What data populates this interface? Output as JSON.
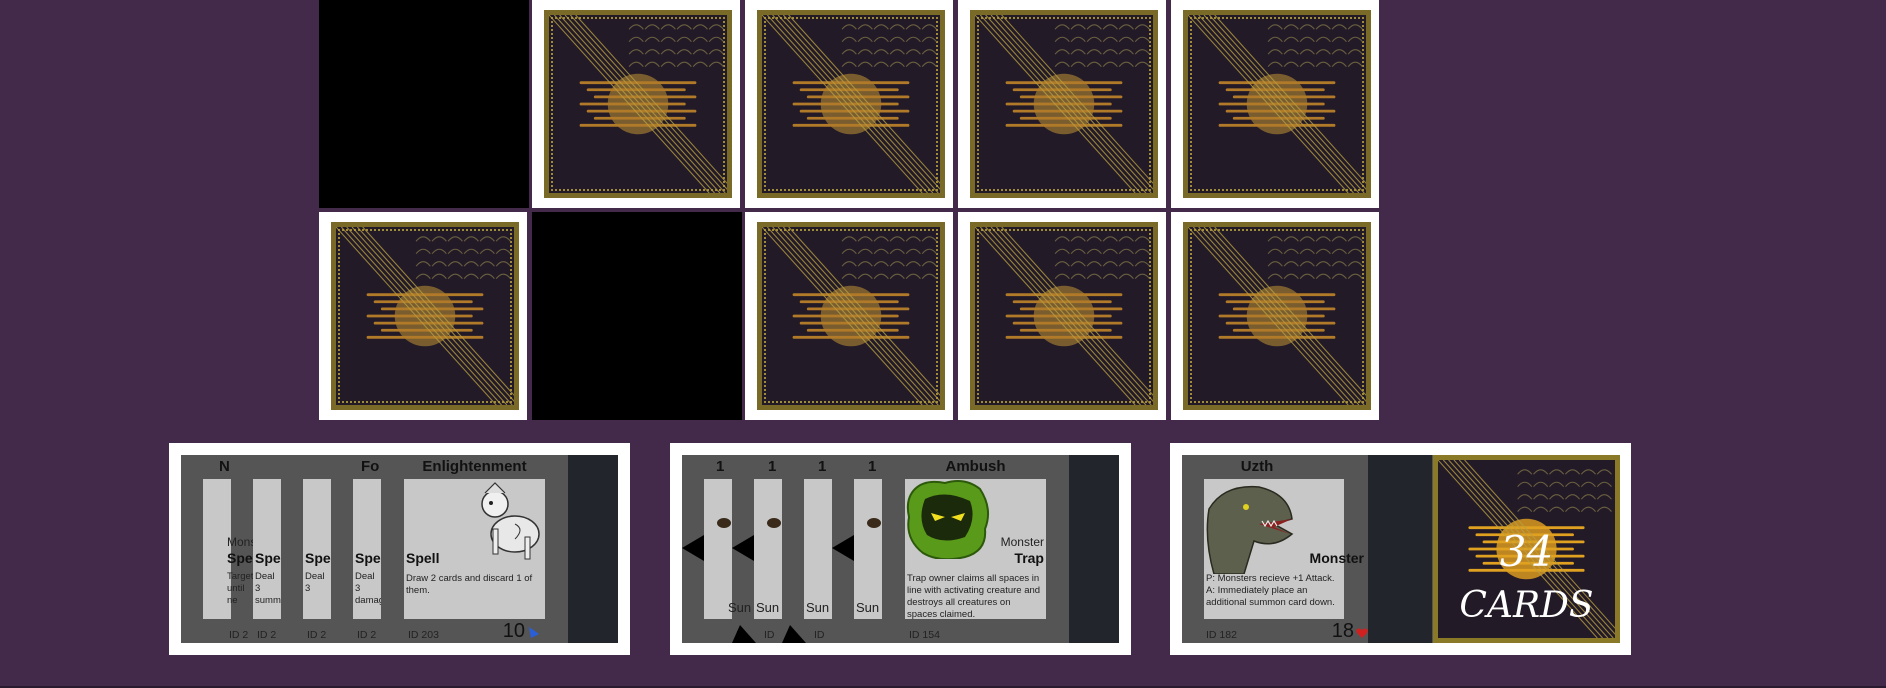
{
  "board": {
    "rows": [
      [
        "empty",
        "back",
        "back",
        "back",
        "back"
      ],
      [
        "back",
        "empty",
        "back",
        "back",
        "back"
      ]
    ]
  },
  "hand1": {
    "slim_cards": [
      {
        "title": "N",
        "type": "Spe",
        "sub": "Mons",
        "desc": "Target until ne",
        "id": "ID  2"
      },
      {
        "title": "",
        "type": "Spe",
        "sub": "",
        "desc": "Deal 3 summ",
        "id": "ID  2"
      },
      {
        "title": "",
        "type": "Spe",
        "sub": "",
        "desc": "Deal 3",
        "id": "ID  2"
      },
      {
        "title": "Fo",
        "type": "Spe",
        "sub": "",
        "desc": "Deal 3 damag",
        "id": "ID  2"
      }
    ],
    "main": {
      "title": "Enlightenment",
      "type": "Spell",
      "desc": "Draw 2 cards and discard 1 of them.",
      "id": "ID  203",
      "value": "10",
      "value_icon": "blue-flag-icon",
      "art": "white-sphinx-creature"
    }
  },
  "hand2": {
    "slim_cards": [
      {
        "title": "1",
        "sub": "Sun",
        "id": "ID"
      },
      {
        "title": "1",
        "sub": "Sun",
        "id": "ID"
      },
      {
        "title": "1",
        "sub": "Sun",
        "id": "ID"
      },
      {
        "title": "1",
        "sub": "Sun",
        "id": "ID"
      }
    ],
    "main": {
      "title": "Ambush",
      "sub": "Monster",
      "type": "Trap",
      "desc": "Trap owner claims all spaces in line with activating creature and destroys all creatures on spaces claimed.",
      "id": "ID  154",
      "art": "green-bush-eyes"
    }
  },
  "hand3": {
    "main": {
      "title": "Uzth",
      "type": "Monster",
      "desc": "P: Monsters recieve +1 Attack.\nA: Immediately place an additional summon card down.",
      "id": "ID  182",
      "value": "18",
      "value_icon": "heart-icon",
      "art": "dragon-head"
    },
    "deck": {
      "count": "34",
      "label": "CARDS"
    }
  },
  "colors": {
    "background": "#43294a",
    "card_back": "#231a28",
    "gold": "#c9a23a",
    "panel_gray": "#555555",
    "card_face": "#c8c8c8"
  }
}
